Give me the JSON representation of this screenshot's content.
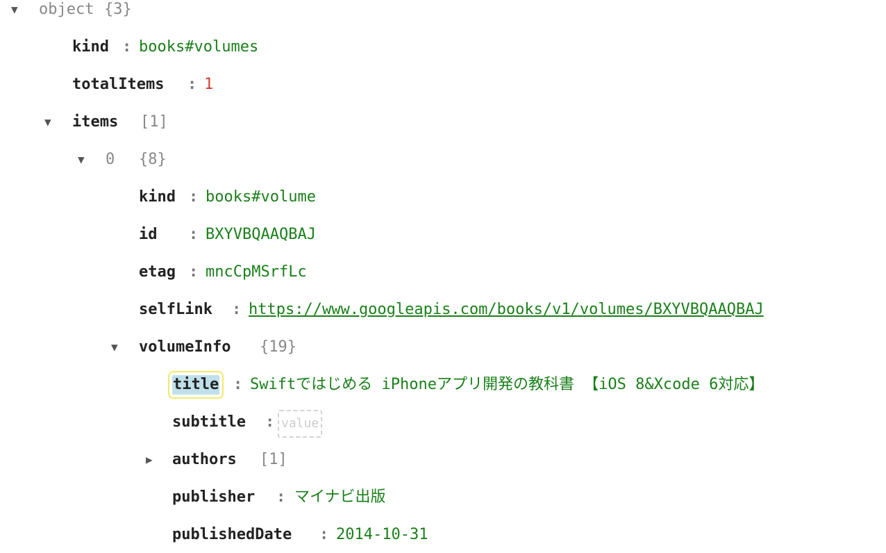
{
  "root": {
    "label": "object",
    "count": "{3}"
  },
  "kind": {
    "key": "kind",
    "value": "books#volumes"
  },
  "totalItems": {
    "key": "totalItems",
    "value": "1"
  },
  "items": {
    "key": "items",
    "count": "[1]"
  },
  "item0": {
    "index": "0",
    "count": "{8}",
    "kind": {
      "key": "kind",
      "value": "books#volume"
    },
    "id": {
      "key": "id",
      "value": "BXYVBQAAQBAJ"
    },
    "etag": {
      "key": "etag",
      "value": "mncCpMSrfLc"
    },
    "selfLink": {
      "key": "selfLink",
      "value": "https://www.googleapis.com/books/v1/volumes/BXYVBQAAQBAJ"
    },
    "volumeInfo": {
      "key": "volumeInfo",
      "count": "{19}",
      "title": {
        "key": "title",
        "value": "Swiftではじめる iPhoneアプリ開発の教科書 【iOS 8&Xcode 6対応】"
      },
      "subtitle": {
        "key": "subtitle",
        "placeholder": "value"
      },
      "authors": {
        "key": "authors",
        "count": "[1]"
      },
      "publisher": {
        "key": "publisher",
        "value": "マイナビ出版"
      },
      "publishedDate": {
        "key": "publishedDate",
        "value": "2014-10-31"
      }
    }
  },
  "icons": {
    "expanded": "▼",
    "collapsed": "▶"
  },
  "colors": {
    "string": "#1a7f1a",
    "number": "#d63a2f",
    "count": "#888888",
    "highlight": "#bfe0ea",
    "highlight_outline": "#f2e86a"
  }
}
